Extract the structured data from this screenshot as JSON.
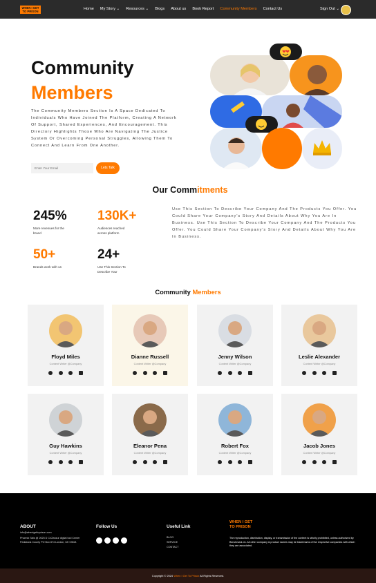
{
  "nav": {
    "logo_text": "WHEN I GET TO PRISON",
    "items": [
      {
        "label": "Home"
      },
      {
        "label": "My Story ⌄"
      },
      {
        "label": "Resources ⌄"
      },
      {
        "label": "Blogs"
      },
      {
        "label": "About us"
      },
      {
        "label": "Book Report"
      },
      {
        "label": "Community Members"
      },
      {
        "label": "Contact Us"
      }
    ],
    "active": "Community Members",
    "signout": "Sign Out ⌄"
  },
  "hero": {
    "title_1": "Community",
    "title_2": "Members",
    "description": "The Community Members Section Is A Space Dedicated To Individuals Who Have Joined The Platform, Creating A Network Of Support, Shared Experiences, And Encouragement. This Directory Highlights Those Who Are Navigating The Justice System Or Overcoming Personal Struggles, Allowing Them To Connect And Learn From One Another.",
    "email_placeholder": "Enter Your Email",
    "talk_button": "Lets Talk"
  },
  "commitments": {
    "title_black": "Our Comm",
    "title_orange": "itments",
    "stats": [
      {
        "value": "245%",
        "label": "More revenues for the brand",
        "color": "#111111"
      },
      {
        "value": "130K+",
        "label": "Audiences reached across platform",
        "color": "#ff7a00"
      },
      {
        "value": "50+",
        "label": "Brands work with us",
        "color": "#ff7a00"
      },
      {
        "value": "24+",
        "label": "Use This Section To Describe Your",
        "color": "#111111"
      }
    ],
    "description": "Use This Section To Describe Your Company And The Products You Offer. You Could Share Your Company's Story And Details About Why You Are In Business. Use This Section To Describe Your Company And The Products You Offer. You Could Share Your Company's Story And Details About Why You Are In Business."
  },
  "members": {
    "title_black": "Community",
    "title_orange": "Members",
    "list": [
      {
        "name": "Floyd Miles",
        "role": "Content Writer @Company"
      },
      {
        "name": "Dianne Russell",
        "role": "Content Writer @Company"
      },
      {
        "name": "Jenny Wilson",
        "role": "Content Writer @Company"
      },
      {
        "name": "Leslie Alexander",
        "role": "Content Writer @Company"
      },
      {
        "name": "Guy Hawkins",
        "role": "Content Writer @Company"
      },
      {
        "name": "Eleanor Pena",
        "role": "Content Writer @Company"
      },
      {
        "name": "Robert Fox",
        "role": "Content Writer @Company"
      },
      {
        "name": "Jacob Jones",
        "role": "Content Writer @Company"
      }
    ],
    "social_icons": [
      "facebook-icon",
      "twitter-icon",
      "instagram-icon",
      "linkedin-icon"
    ]
  },
  "footer": {
    "about_title": "ABOUT",
    "about_email": "info@whenigettoprison.com",
    "about_address": "Phoenix Talis @ 2025 D Cr/Zanzur digital tool Center Parklands County PO Box 874 London, UK 03521",
    "follow_title": "Follow Us",
    "follow_icons": [
      "youtube-icon",
      "twitter-icon",
      "facebook-icon",
      "instagram-icon"
    ],
    "links_title": "Useful Link",
    "links": [
      "BLOG",
      "SERVICE",
      "CONTACT"
    ],
    "brand": "WHEN I GET TO PRISON",
    "legal": "The reproduction, distribution, display, or transmission of the content is strictly prohibited, unless authorized by Benchmark Jo. All other company & product names may be trademarks of the respective companies with which they are associated."
  },
  "copyright": {
    "prefix": "Copyright © 2024",
    "brand": "When I Get To Prison",
    "suffix": "All Rights Reserved."
  },
  "colors": {
    "accent": "#ff7a00",
    "nav_bg": "#2b2b2b",
    "footer_bg": "#000000",
    "bottom_bg": "#2a1712"
  }
}
